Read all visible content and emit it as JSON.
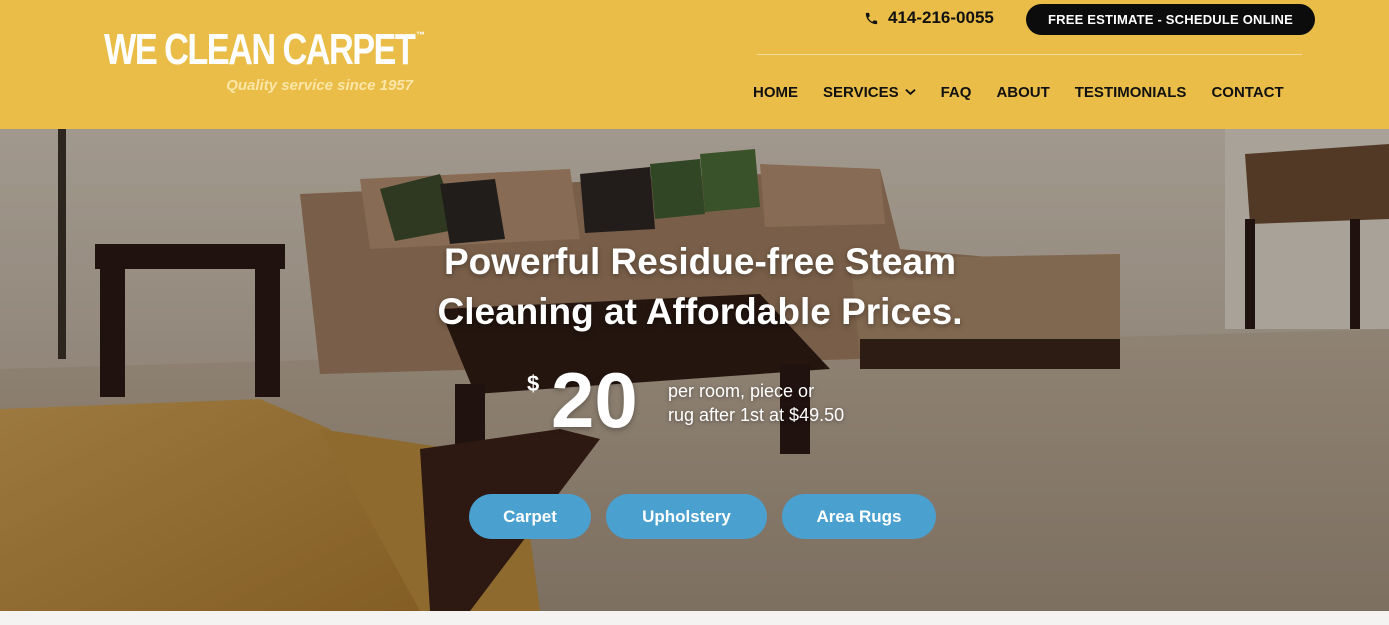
{
  "header": {
    "logo_text": "WE CLEAN CARPET",
    "logo_tm": "™",
    "tagline": "Quality service since 1957",
    "phone": "414-216-0055",
    "cta_label": "FREE ESTIMATE - SCHEDULE ONLINE",
    "nav": [
      {
        "label": "HOME"
      },
      {
        "label": "SERVICES",
        "has_dropdown": true
      },
      {
        "label": "FAQ"
      },
      {
        "label": "ABOUT"
      },
      {
        "label": "TESTIMONIALS"
      },
      {
        "label": "CONTACT"
      }
    ]
  },
  "hero": {
    "headline_line1": "Powerful Residue-free Steam",
    "headline_line2": "Cleaning at Affordable Prices.",
    "price_currency": "$",
    "price_amount": "20",
    "price_note_line1": "per room, piece or",
    "price_note_line2": "rug after 1st at $49.50",
    "buttons": [
      {
        "label": "Carpet"
      },
      {
        "label": "Upholstery"
      },
      {
        "label": "Area Rugs"
      }
    ]
  },
  "icons": [
    "phone-icon",
    "chevron-down-icon"
  ],
  "colors": {
    "header_bg": "#e9bd48",
    "cta_bg": "#0c0c0c",
    "button_bg": "#4aa0cf",
    "tagline": "#fbe6a7"
  }
}
